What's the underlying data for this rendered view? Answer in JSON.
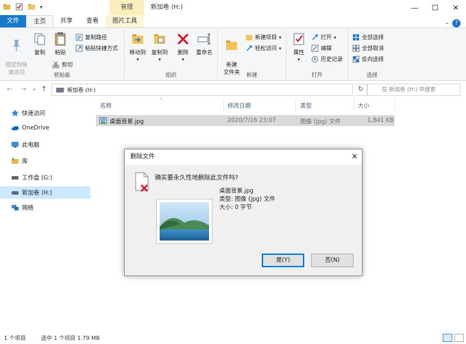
{
  "window": {
    "title": "新加卷 (H:)",
    "contextual_tab": "管理",
    "controls": {
      "minimize": "—",
      "maximize": "☐",
      "close": "✕"
    }
  },
  "ribbon_tabs": [
    {
      "label": "文件"
    },
    {
      "label": "主页"
    },
    {
      "label": "共享"
    },
    {
      "label": "查看"
    },
    {
      "label": "图片工具"
    }
  ],
  "ribbon": {
    "clipboard": {
      "label": "剪贴板",
      "pin": "固定到快\n速访问",
      "copy": "复制",
      "paste": "粘贴",
      "copy_path": "复制路径",
      "paste_shortcut": "粘贴快捷方式",
      "cut": "剪切"
    },
    "organize": {
      "label": "组织",
      "move_to": "移动到",
      "copy_to": "复制到",
      "delete": "删除",
      "rename": "重命名"
    },
    "new": {
      "label": "新建",
      "new_folder": "新建\n文件夹",
      "new_item": "新建项目",
      "easy_access": "轻松访问"
    },
    "open": {
      "label": "打开",
      "properties": "属性",
      "open": "打开",
      "edit": "编辑",
      "history": "历史记录"
    },
    "select": {
      "label": "选择",
      "select_all": "全部选择",
      "select_none": "全部取消",
      "invert": "反向选择"
    }
  },
  "address_bar": {
    "path": "新加卷 (H:)",
    "search_placeholder": "在 新加卷 (H:) 中搜索"
  },
  "nav_pane": {
    "items": [
      {
        "label": "快速访问"
      },
      {
        "label": "OneDrive"
      },
      {
        "label": "此电脑"
      },
      {
        "label": "库"
      },
      {
        "label": "工作盘 (G:)"
      },
      {
        "label": "新加卷 (H:)"
      },
      {
        "label": "网络"
      }
    ]
  },
  "file_list": {
    "columns": [
      "名称",
      "修改日期",
      "类型",
      "大小"
    ],
    "rows": [
      {
        "name": "桌面背景.jpg",
        "modified": "2020/7/16 23:07",
        "type": "图像 (jpg) 文件",
        "size": "1,841 KB"
      }
    ]
  },
  "status_bar": {
    "count": "1 个项目",
    "selected": "选中 1 个项目  1.79 MB"
  },
  "dialog": {
    "title": "删除文件",
    "question": "确实要永久性地删除此文件吗?",
    "file_name": "桌面背景.jpg",
    "file_type": "类型: 图像 (jpg) 文件",
    "file_size": "大小: 0 字节",
    "yes": "是(Y)",
    "no": "否(N)"
  },
  "colors": {
    "accent": "#1979ca",
    "selection": "#cce8ff",
    "contextual": "#fbeebc",
    "delete_red": "#d6182c"
  }
}
